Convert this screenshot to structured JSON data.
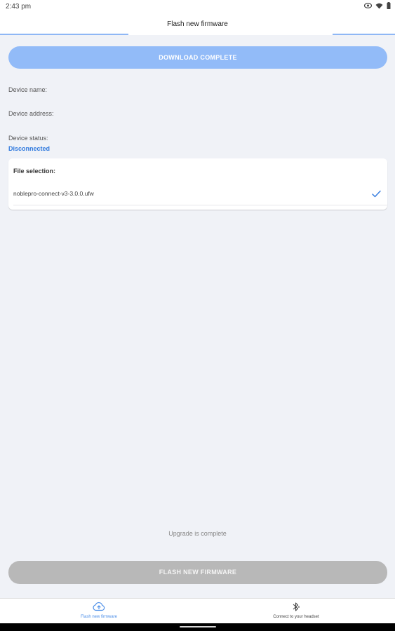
{
  "status_bar": {
    "time": "2:43 pm",
    "icons": [
      "eye-icon",
      "wifi-icon",
      "battery-icon"
    ]
  },
  "app_bar": {
    "title": "Flash new firmware",
    "progress_color": "#8fb7f5"
  },
  "download_button": {
    "label": "DOWNLOAD COMPLETE",
    "color": "#92bbf8"
  },
  "device": {
    "name_label": "Device name:",
    "address_label": "Device address:",
    "status_label": "Device status:",
    "status_value": "Disconnected",
    "status_color": "#2f79de"
  },
  "file_selection": {
    "heading": "File selection:",
    "files": [
      {
        "name": "noblepro-connect-v3-3.0.0.ufw",
        "selected": true
      }
    ]
  },
  "upgrade_message": "Upgrade is complete",
  "flash_button": {
    "label": "FLASH NEW FIRMWARE",
    "color": "#b8b8b8"
  },
  "bottom_nav": {
    "items": [
      {
        "label": "Flash new firmware",
        "icon": "cloud-upload-icon",
        "active": true
      },
      {
        "label": "Connect to your headset",
        "icon": "bluetooth-icon",
        "active": false
      }
    ]
  }
}
